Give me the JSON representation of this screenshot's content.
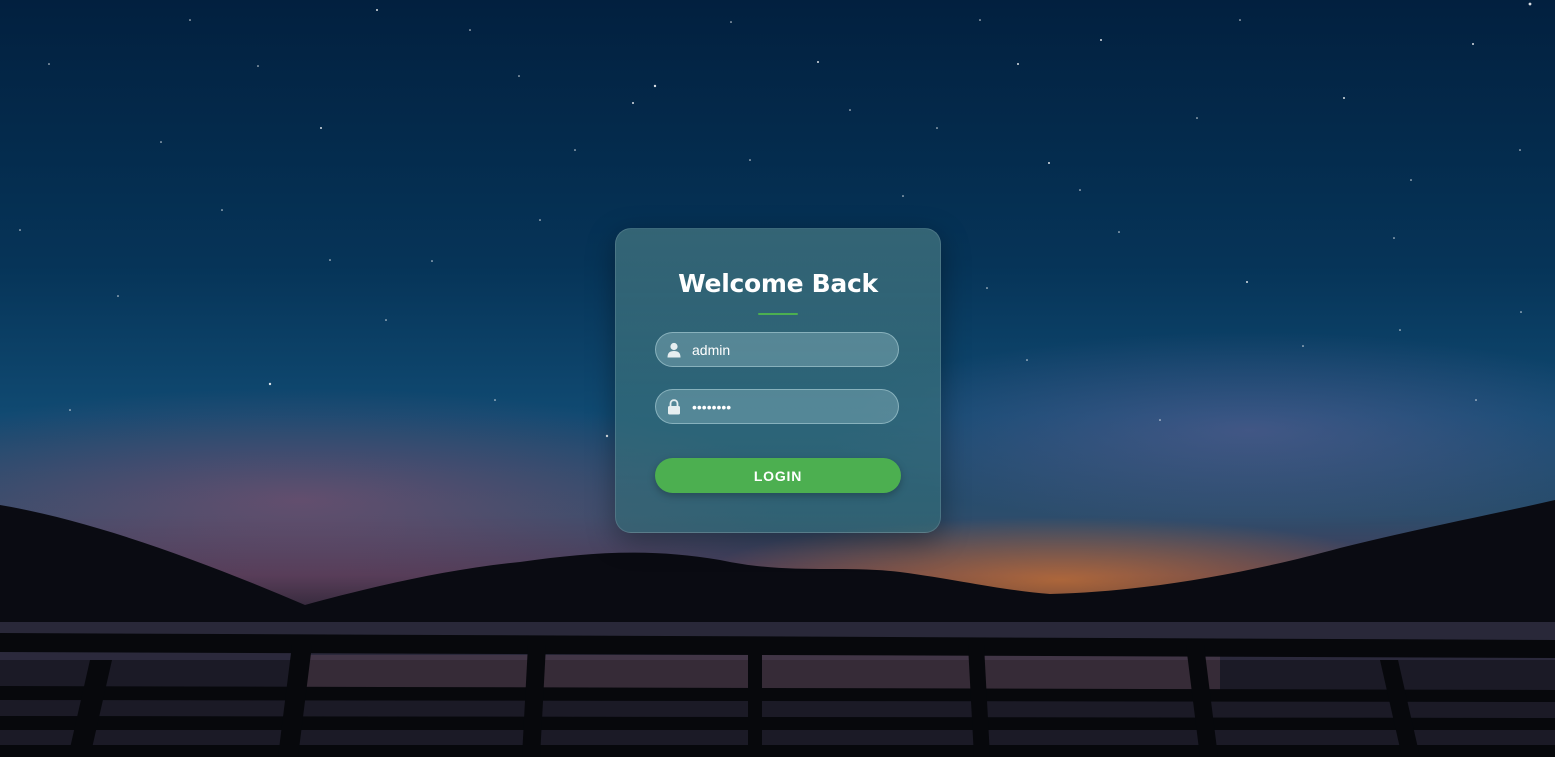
{
  "login": {
    "title": "Welcome Back",
    "username": {
      "value": "admin",
      "icon": "user-icon"
    },
    "password": {
      "value": "secret12",
      "icon": "lock-icon"
    },
    "button_label": "LOGIN"
  },
  "colors": {
    "accent": "#4caf50",
    "title_text": "#ffffff"
  }
}
